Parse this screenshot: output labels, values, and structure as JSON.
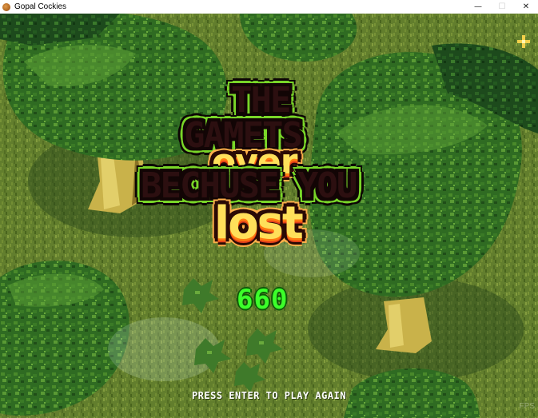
{
  "window": {
    "title": "Gopal Cockies",
    "icon": "cookie-icon",
    "controls": {
      "minimize": "—",
      "maximize": "☐",
      "close": "✕"
    }
  },
  "game_over": {
    "line1": "THE",
    "line2": "GAMETS",
    "word_over": "over",
    "line3": "BECHUSE YOU",
    "word_lost": "lost"
  },
  "score": "660",
  "prompt": "PRESS ENTER TO PLAY AGAIN",
  "watermark": "FPS",
  "colors": {
    "title_fill": "#2c0f10",
    "title_outline": "#79d628",
    "accent_fill": "#ffe05a",
    "accent_outline": "#ffb04a",
    "score": "#3cff2a",
    "grass": "#6d8a33",
    "canopy": "#2f6b22"
  }
}
